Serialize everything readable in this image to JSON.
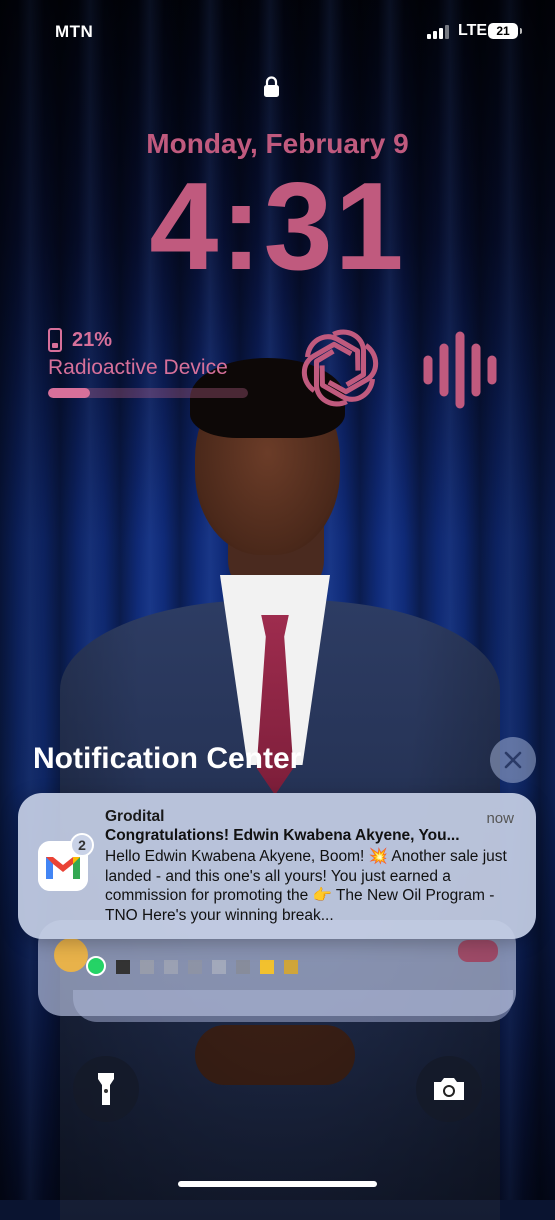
{
  "status_bar": {
    "carrier": "MTN",
    "network": "LTE",
    "battery_level": "21"
  },
  "lock_screen": {
    "date": "Monday, February 9",
    "time": "4:31",
    "battery_widget": {
      "percent": "21%",
      "device_name": "Radioactive Device",
      "level_fraction": 0.21
    },
    "widgets": [
      "openai-icon",
      "sound-wave-icon"
    ]
  },
  "notification_center": {
    "title": "Notification Center",
    "close_icon": "close-icon",
    "notification": {
      "app_icon": "gmail-icon",
      "badge_count": "2",
      "sender": "Grodital",
      "time": "now",
      "title": "Congratulations! Edwin Kwabena Akyene, You...",
      "body": "Hello Edwin Kwabena Akyene, Boom! 💥 Another sale just landed - and this one's all yours! You just earned a commission for promoting the 👉 The New Oil Program - TNO Here's your winning break..."
    }
  },
  "quick_actions": {
    "left": "flashlight-icon",
    "right": "camera-icon"
  },
  "colors": {
    "accent_pink": "#c05a7e",
    "widget_pink": "#d7709a"
  }
}
